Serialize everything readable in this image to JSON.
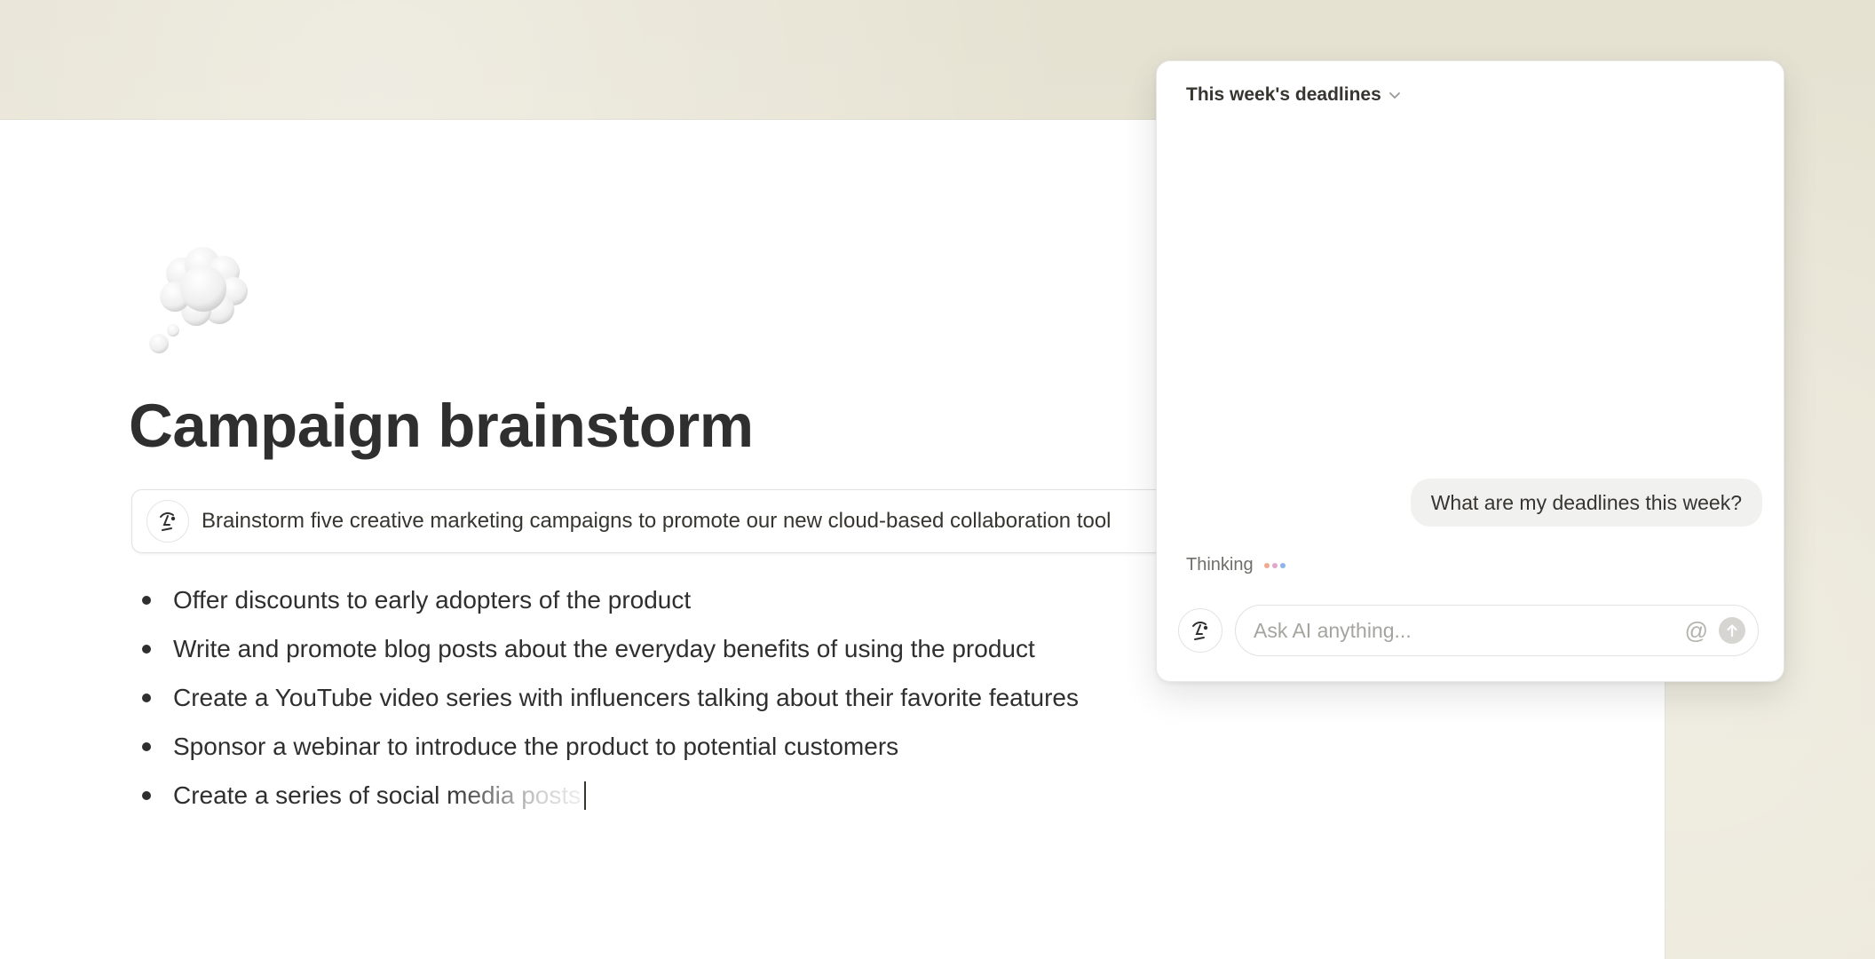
{
  "document": {
    "title": "Campaign brainstorm",
    "page_icon": "thought-balloon-icon",
    "prompt": {
      "icon": "ai-face-icon",
      "text": "Brainstorm five creative marketing campaigns to promote our new cloud-based collaboration tool"
    },
    "bullets": [
      "Offer discounts to early adopters of the product",
      "Write and promote blog posts about the everyday benefits of using the product",
      "Create a YouTube video series with influencers talking about their favorite features",
      "Sponsor a webinar to introduce the product to potential customers"
    ],
    "typing_bullet": {
      "solid_text": "Create a series of ",
      "fading_text": "social media posts"
    }
  },
  "ai_panel": {
    "header": "This week's deadlines",
    "user_message": "What are my deadlines this week?",
    "status": "Thinking",
    "dot_colors": [
      "#f2a98f",
      "#e3a8c9",
      "#8fb4e6"
    ],
    "input": {
      "placeholder": "Ask AI anything...",
      "value": "",
      "mention_icon": "@",
      "send_icon": "arrow-up-icon"
    }
  }
}
